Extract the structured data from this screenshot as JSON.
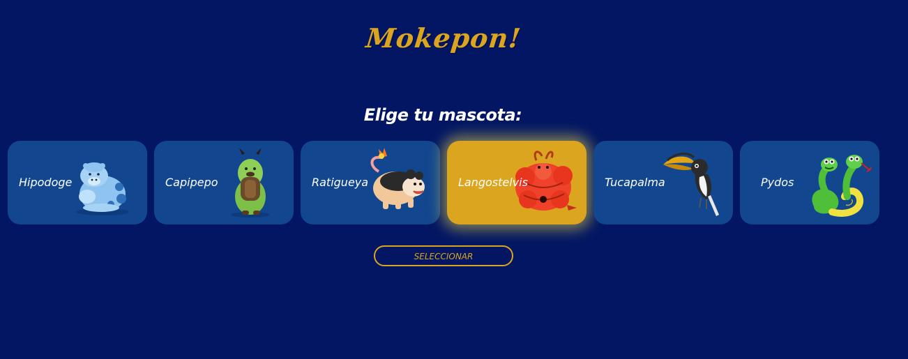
{
  "app": {
    "title": "Mokepon!"
  },
  "main": {
    "subtitle": "Elige tu mascota:",
    "select_button": "SELECCIONAR",
    "selected_pet": "Langostelvis"
  },
  "pets": [
    {
      "name": "Hipodoge",
      "icon": "hipodoge-icon"
    },
    {
      "name": "Capipepo",
      "icon": "capipepo-icon"
    },
    {
      "name": "Ratigueya",
      "icon": "ratigueya-icon"
    },
    {
      "name": "Langostelvis",
      "icon": "langostelvis-icon"
    },
    {
      "name": "Tucapalma",
      "icon": "tucapalma-icon"
    },
    {
      "name": "Pydos",
      "icon": "pydos-icon"
    }
  ],
  "colors": {
    "background": "#021663",
    "card": "#12468F",
    "accent": "#DBA520",
    "glow": "#EEDC46",
    "text": "#FFFFFF"
  }
}
